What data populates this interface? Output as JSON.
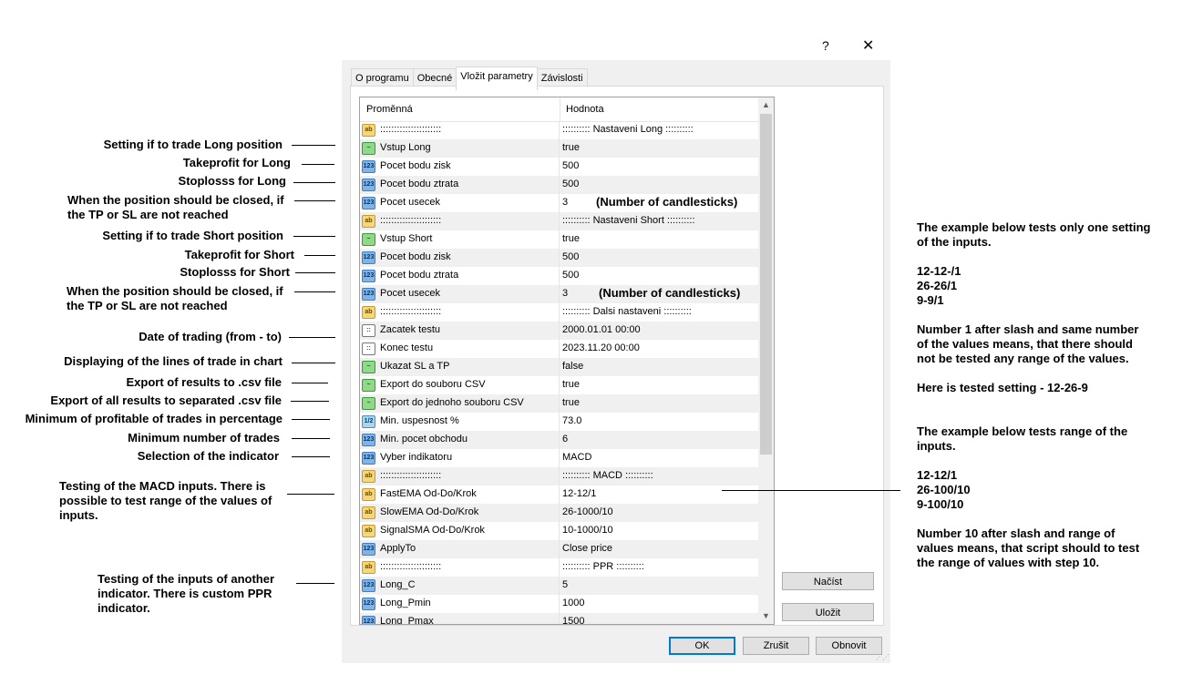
{
  "window": {
    "help": "?",
    "close": "✕"
  },
  "tabs": [
    {
      "label": "O programu",
      "active": false
    },
    {
      "label": "Obecné",
      "active": false
    },
    {
      "label": "Vložit parametry",
      "active": true
    },
    {
      "label": "Závislosti",
      "active": false
    }
  ],
  "grid": {
    "col_variable": "Proměnná",
    "col_value": "Hodnota",
    "rows": [
      {
        "icon": "ab",
        "name": "::::::::::::::::::::::",
        "value": ":::::::::: Nastaveni Long ::::::::::"
      },
      {
        "icon": "bool",
        "name": "Vstup Long",
        "value": "true"
      },
      {
        "icon": "num",
        "name": "Pocet bodu zisk",
        "value": "500"
      },
      {
        "icon": "num",
        "name": "Pocet bodu ztrata",
        "value": "500"
      },
      {
        "icon": "num",
        "name": "Pocet usecek",
        "value": "3",
        "note": "(Number of candlesticks)"
      },
      {
        "icon": "ab",
        "name": "::::::::::::::::::::::",
        "value": ":::::::::: Nastaveni Short ::::::::::"
      },
      {
        "icon": "bool",
        "name": "Vstup Short",
        "value": "true"
      },
      {
        "icon": "num",
        "name": "Pocet bodu zisk",
        "value": "500"
      },
      {
        "icon": "num",
        "name": "Pocet bodu ztrata",
        "value": "500"
      },
      {
        "icon": "num",
        "name": "Pocet usecek",
        "value": "3",
        "note": "(Number of candlesticks)"
      },
      {
        "icon": "ab",
        "name": "::::::::::::::::::::::",
        "value": ":::::::::: Dalsi nastaveni ::::::::::"
      },
      {
        "icon": "dt",
        "name": "Zacatek testu",
        "value": "2000.01.01 00:00"
      },
      {
        "icon": "dt",
        "name": "Konec testu",
        "value": "2023.11.20 00:00"
      },
      {
        "icon": "bool",
        "name": "Ukazat SL a TP",
        "value": "false"
      },
      {
        "icon": "bool",
        "name": "Export do souboru CSV",
        "value": "true"
      },
      {
        "icon": "bool",
        "name": "Export do jednoho souboru CSV",
        "value": "true"
      },
      {
        "icon": "dbl",
        "name": "Min. uspesnost %",
        "value": "73.0"
      },
      {
        "icon": "num",
        "name": "Min. pocet obchodu",
        "value": "6"
      },
      {
        "icon": "num",
        "name": "Vyber indikatoru",
        "value": "MACD"
      },
      {
        "icon": "ab",
        "name": "::::::::::::::::::::::",
        "value": ":::::::::: MACD ::::::::::"
      },
      {
        "icon": "ab",
        "name": "FastEMA Od-Do/Krok",
        "value": "12-12/1"
      },
      {
        "icon": "ab",
        "name": "SlowEMA Od-Do/Krok",
        "value": "26-1000/10"
      },
      {
        "icon": "ab",
        "name": "SignalSMA Od-Do/Krok",
        "value": "10-1000/10"
      },
      {
        "icon": "num",
        "name": "ApplyTo",
        "value": "Close price"
      },
      {
        "icon": "ab",
        "name": "::::::::::::::::::::::",
        "value": ":::::::::: PPR ::::::::::"
      },
      {
        "icon": "num",
        "name": "Long_C",
        "value": "5"
      },
      {
        "icon": "num",
        "name": "Long_Pmin",
        "value": "1000"
      },
      {
        "icon": "num",
        "name": "Long_Pmax",
        "value": "1500"
      }
    ]
  },
  "buttons": {
    "load": "Načíst",
    "save": "Uložit",
    "ok": "OK",
    "cancel": "Zrušit",
    "reset": "Obnovit"
  },
  "annotations_left": [
    "Setting if to trade Long position",
    "Takeprofit for Long",
    "Stoplosss for Long",
    "When the position should be closed, if\nthe TP or SL are not reached",
    "Setting if to trade Short position",
    "Takeprofit for Short",
    "Stoplosss for Short",
    "When the position should be closed, if\nthe TP or SL are not reached",
    "Date of trading (from - to)",
    "Displaying of the lines of trade in chart",
    "Export of results to .csv file",
    "Export of all results to separated .csv file",
    "Minimum of profitable of trades in percentage",
    "Minimum number of trades",
    "Selection of the indicator",
    "Testing of the MACD inputs. There is\npossible to test range of the values of\ninputs.",
    "Testing of the inputs of another\nindicator. There is custom PPR\nindicator."
  ],
  "annotations_right": {
    "example1_intro": "The example below tests only one setting of the inputs.",
    "example1_lines": [
      "12-12-/1",
      "26-26/1",
      "9-9/1"
    ],
    "example1_desc": "Number 1 after slash and same number of the values means, that there should not be tested any range of the values.",
    "example1_tested": "Here is tested setting - 12-26-9",
    "example2_intro": "The example below tests range of the inputs.",
    "example2_lines": [
      "12-12/1",
      "26-100/10",
      "9-100/10"
    ],
    "example2_desc": "Number 10 after slash and range of values means, that script should to test the range of values with step 10."
  }
}
